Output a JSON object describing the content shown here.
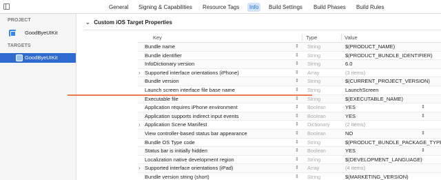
{
  "tabs": [
    {
      "label": "General",
      "active": false
    },
    {
      "label": "Signing & Capabilities",
      "active": false
    },
    {
      "label": "Resource Tags",
      "active": false
    },
    {
      "label": "Info",
      "active": true
    },
    {
      "label": "Build Settings",
      "active": false
    },
    {
      "label": "Build Phases",
      "active": false
    },
    {
      "label": "Build Rules",
      "active": false
    }
  ],
  "sidebar": {
    "project_header": "PROJECT",
    "project_item": "GoodByeUIKit",
    "targets_header": "TARGETS",
    "target_item": "GoodByeUIKit"
  },
  "section": {
    "title": "Custom iOS Target Properties"
  },
  "table": {
    "headers": {
      "key": "Key",
      "type": "Type",
      "value": "Value"
    },
    "rows": [
      {
        "key": "Bundle name",
        "type": "String",
        "value": "$(PRODUCT_NAME)"
      },
      {
        "key": "Bundle identifier",
        "type": "String",
        "value": "$(PRODUCT_BUNDLE_IDENTIFIER)"
      },
      {
        "key": "InfoDictionary version",
        "type": "String",
        "value": "6.0"
      },
      {
        "key": "Supported interface orientations (iPhone)",
        "type": "Array",
        "value": "(3 items)",
        "expandable": true
      },
      {
        "key": "Bundle version",
        "type": "String",
        "value": "$(CURRENT_PROJECT_VERSION)"
      },
      {
        "key": "Launch screen interface file base name",
        "type": "String",
        "value": "LaunchScreen"
      },
      {
        "key": "Executable file",
        "type": "String",
        "value": "$(EXECUTABLE_NAME)"
      },
      {
        "key": "Application requires iPhone environment",
        "type": "Boolean",
        "value": "YES",
        "popup": true
      },
      {
        "key": "Application supports indirect input events",
        "type": "Boolean",
        "value": "YES",
        "popup": true
      },
      {
        "key": "Application Scene Manifest",
        "type": "Dictionary",
        "value": "(2 items)",
        "expandable": true
      },
      {
        "key": "View controller-based status bar appearance",
        "type": "Boolean",
        "value": "NO",
        "popup": true
      },
      {
        "key": "Bundle OS Type code",
        "type": "String",
        "value": "$(PRODUCT_BUNDLE_PACKAGE_TYPE)"
      },
      {
        "key": "Status bar is initially hidden",
        "type": "Boolean",
        "value": "YES",
        "popup": true
      },
      {
        "key": "Localization native development region",
        "type": "String",
        "value": "$(DEVELOPMENT_LANGUAGE)"
      },
      {
        "key": "Supported interface orientations (iPad)",
        "type": "Array",
        "value": "(4 items)",
        "expandable": true
      },
      {
        "key": "Bundle version string (short)",
        "type": "String",
        "value": "$(MARKETING_VERSION)"
      }
    ]
  },
  "colors": {
    "selection": "#2f6ad0",
    "active_tab_bg": "#d3e4f8",
    "active_tab_text": "#1d6fd6",
    "highlight_line": "#ee7a4b"
  }
}
